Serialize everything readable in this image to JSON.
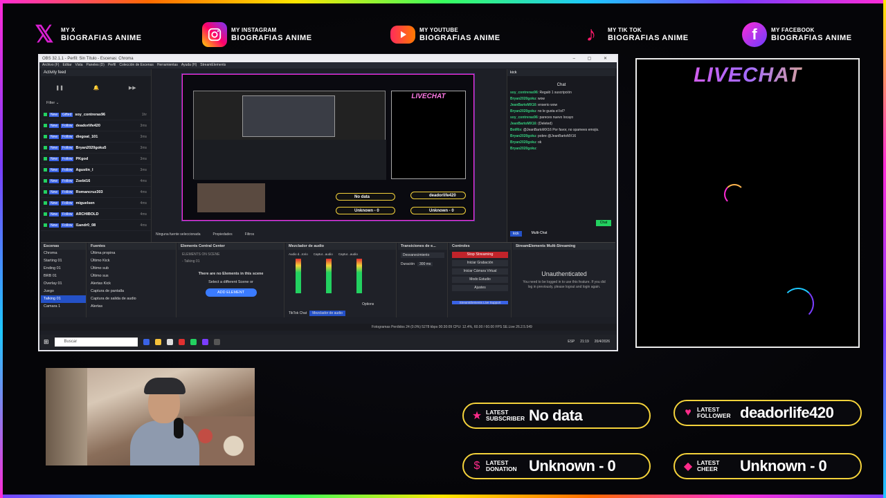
{
  "socials": [
    {
      "platform": "x",
      "line1": "MY X",
      "line2": "BIOGRAFIAS ANIME"
    },
    {
      "platform": "instagram",
      "line1": "MY INSTAGRAM",
      "line2": "BIOGRAFIAS ANIME"
    },
    {
      "platform": "youtube",
      "line1": "MY YOUTUBE",
      "line2": "BIOGRAFIAS ANIME"
    },
    {
      "platform": "tiktok",
      "line1": "MY TIK TOK",
      "line2": "BIOGRAFIAS ANIME"
    },
    {
      "platform": "facebook",
      "line1": "MY FACEBOOK",
      "line2": "BIOGRAFIAS ANIME"
    }
  ],
  "obs": {
    "title": "OBS 32.1.1 - Perfil: Sin Título - Escenas: Chroma",
    "menu": [
      "Archivo (F)",
      "Editar",
      "Vista",
      "Paneles (D)",
      "Perfil",
      "Colección de Escenas",
      "Herramientas",
      "Ayuda (H)",
      "StreamElements"
    ],
    "activity_title": "Activity feed",
    "filter_label": "Filter",
    "activity": [
      {
        "tag": "Gifted",
        "count": "14",
        "name": "soy_contreras96",
        "time": "1hr"
      },
      {
        "tag": "Follow",
        "name": "deadorlife420",
        "time": "3ms"
      },
      {
        "tag": "Follow",
        "name": "diegoat_101",
        "time": "3ms"
      },
      {
        "tag": "Follow",
        "name": "Bryan2020goku5",
        "time": "3ms"
      },
      {
        "tag": "Follow",
        "name": "PKgod",
        "time": "3ms"
      },
      {
        "tag": "Follow",
        "name": "Agustin_l",
        "time": "3ms"
      },
      {
        "tag": "Follow",
        "name": "Zsebt16",
        "time": "4ms"
      },
      {
        "tag": "Follow",
        "name": "Romancruz303",
        "time": "4ms"
      },
      {
        "tag": "Follow",
        "name": "miguelsen",
        "time": "4ms"
      },
      {
        "tag": "Follow",
        "name": "ARCHIBOLD",
        "time": "4ms"
      },
      {
        "tag": "Follow",
        "name": "l1andr0_08",
        "time": "4ms"
      }
    ],
    "preview": {
      "livechat": "LIVECHAT",
      "no_data": "No data",
      "deador": "deadorlife420",
      "unknown1": "Unknown - 0",
      "unknown2": "Unknown - 0"
    },
    "chat": {
      "tab": "kick",
      "title": "Chat",
      "lines": [
        {
          "user": "soy_contreras96",
          "msg": "Regaló 1 suscripción"
        },
        {
          "user": "Bryan2020goku",
          "msg": "wow"
        },
        {
          "user": "JeanBartoMX16",
          "msg": "enserio wow"
        },
        {
          "user": "Bryan2020goku",
          "msg": "no le gusta el lol?"
        },
        {
          "user": "soy_contreras96",
          "msg": "pareces nuevo locayo"
        },
        {
          "user": "JeanBartoMX16",
          "msg": "(Deleted)"
        },
        {
          "user": "BotRix",
          "msg": "@JeanBartoMX16 Por favor, no spamees emojis."
        },
        {
          "user": "Bryan2020goku",
          "msg": "pobre @JeanBartoMX16"
        },
        {
          "user": "Bryan2020goku",
          "msg": "ok"
        },
        {
          "user": "Bryan2020goku",
          "msg": ""
        }
      ],
      "chat_btn": "Chat",
      "bottom_tabs": [
        "kick",
        "Multi-Chat"
      ]
    },
    "no_source": "Ninguna fuente seleccionada",
    "props": "Propiedades",
    "filters": "Filtros",
    "docks": {
      "scenes_title": "Escenas",
      "scenes": [
        "Chroma",
        "Starting 01",
        "Ending 01",
        "BRB 01",
        "Overlay 01",
        "Juego",
        "Talking 01",
        "Camara 1"
      ],
      "sources_title": "Fuentes",
      "sources": [
        "Última propina",
        "Último Kick",
        "Último sub",
        "Último sus",
        "Alertas Kick",
        "Captura de pantalla",
        "Captura de salida de audio",
        "Alertas"
      ],
      "ecc_title": "Elements Central Center",
      "ecc_sub": "ELEMENTS ON SCENE",
      "ecc_scene": "- Talking 01",
      "ecc_msg1": "There are no Elements in this scene",
      "ecc_msg2": "Select a different Scene or",
      "ecc_btn": "ADD ELEMENT",
      "add_el": "ADD ELEMENT",
      "mixer_title": "Mezclador de audio",
      "mixer_channels": [
        "Audio d...torio",
        "Captur...audio",
        "Captur...audio"
      ],
      "mixer_tabs": [
        "TikTok Chat",
        "Mezclador de audio"
      ],
      "options": "Options",
      "trans_title": "Transiciones de e...",
      "trans_value": "Desvanecimiento",
      "duration_label": "Duración",
      "duration_value": "300 ms",
      "controls_title": "Controles",
      "controls": [
        "Stop Streaming",
        "Iniciar Grabación",
        "Iniciar Cámara Virtual",
        "Modo Estudio",
        "Ajustes"
      ],
      "se_support": "StreamElements Live Support",
      "multi_title": "StreamElements Multi-Streaming",
      "unauth": "Unauthenticated",
      "unauth_msg": "You need to be logged in to use this feature. If you did log in previously, please logout and login again."
    },
    "status": "Fotogramas Perdidos 24 (0.0%)   5278 kbps   00:30:09   CPU: 12.4%, 60.00 / 60.00 FPS   SE.Live 26.2.5.549",
    "taskbar_search": "Buscar",
    "clock": "21:19",
    "date": "20/4/2026",
    "lang": "ESP"
  },
  "livechat_title": "LIVECHAT",
  "alerts": [
    {
      "label1": "LATEST",
      "label2": "SUBSCRIBER",
      "value": "No data",
      "icon": "star-icon"
    },
    {
      "label1": "LATEST",
      "label2": "FOLLOWER",
      "value": "deadorlife420",
      "icon": "heart-icon"
    },
    {
      "label1": "LATEST",
      "label2": "DONATION",
      "value": "Unknown - 0",
      "icon": "dollar-icon"
    },
    {
      "label1": "LATEST",
      "label2": "CHEER",
      "value": "Unknown - 0",
      "icon": "diamond-icon"
    }
  ],
  "colors": {
    "accent_pink": "#ff2bd6",
    "alert_border": "#f5d33b",
    "obs_blue": "#2451c7"
  }
}
